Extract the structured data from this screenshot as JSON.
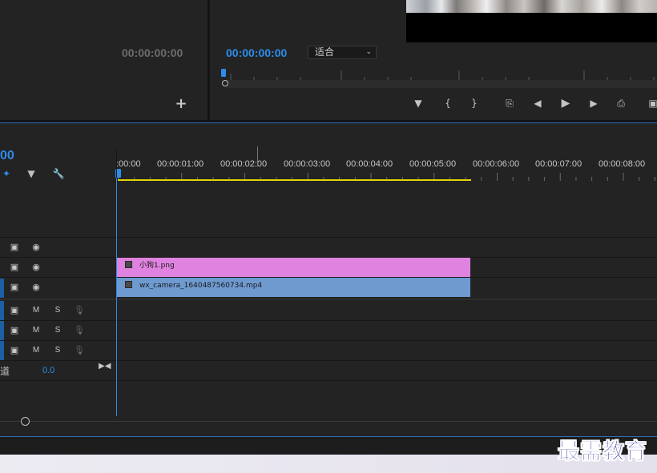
{
  "source_monitor": {
    "timecode": "00:00:00:00",
    "add_icon": "plus-icon"
  },
  "program_monitor": {
    "timecode": "00:00:00:00",
    "zoom_select": {
      "value": "适合"
    },
    "transport": {
      "marker": "marker-icon",
      "mark_in": "{",
      "mark_out": "}",
      "go_to_in": "go-to-in-icon",
      "step_back": "step-back-icon",
      "play": "play-icon",
      "step_forward": "step-forward-icon",
      "go_to_out": "go-to-out-icon",
      "lift": "lift-icon"
    }
  },
  "timeline": {
    "timecode": "00",
    "ruler_labels": [
      ":00:00",
      "00:00:01:00",
      "00:00:02:00",
      "00:00:03:00",
      "00:00:04:00",
      "00:00:05:00",
      "00:00:06:00",
      "00:00:07:00",
      "00:00:08:00"
    ],
    "tracks": {
      "video": [
        {
          "id": "V3",
          "icons": [
            "film-icon",
            "eye-icon"
          ]
        },
        {
          "id": "V2",
          "icons": [
            "film-icon",
            "eye-icon"
          ]
        },
        {
          "id": "V1",
          "icons": [
            "film-icon",
            "eye-icon"
          ]
        }
      ],
      "audio": [
        {
          "id": "A1",
          "mute": "M",
          "solo": "S"
        },
        {
          "id": "A2",
          "mute": "M",
          "solo": "S"
        },
        {
          "id": "A3",
          "mute": "M",
          "solo": "S"
        }
      ]
    },
    "clips": [
      {
        "name": "小狗1.png",
        "track": "V2",
        "color": "#e083e0"
      },
      {
        "name": "wx_camera_1640487560734.mp4",
        "track": "V1",
        "color": "#6e9ad0"
      }
    ],
    "master": {
      "label": "道",
      "value": "0.0"
    }
  },
  "watermark": "最需教育",
  "colors": {
    "accent": "#2d8ceb",
    "workarea": "#e5d200"
  }
}
